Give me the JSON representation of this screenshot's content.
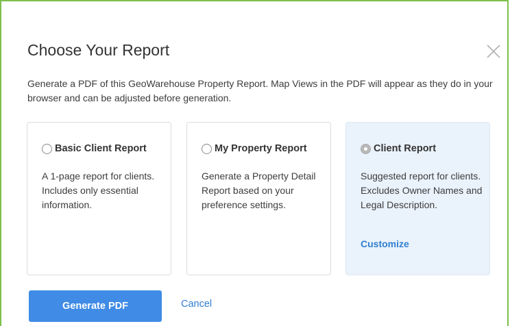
{
  "dialog": {
    "title": "Choose Your Report",
    "close_icon": "close-icon",
    "description": "Generate a PDF of this GeoWarehouse Property Report. Map Views in the PDF will appear as they do in your browser and can be adjusted before generation."
  },
  "options": [
    {
      "label": "Basic Client Report",
      "body": "A 1-page report for clients. Includes only essential information.",
      "selected": false
    },
    {
      "label": "My Property Report",
      "body": "Generate a Property Detail Report based on your preference settings.",
      "selected": false
    },
    {
      "label": "Client Report",
      "body": "Suggested report for clients. Excludes Owner Names and Legal Description.",
      "link": "Customize",
      "selected": true
    }
  ],
  "actions": {
    "generate_label": "Generate PDF",
    "cancel_label": "Cancel"
  },
  "colors": {
    "primary": "#3f8be6",
    "link": "#2f7fd1",
    "selected_card": "#eaf2fb",
    "frame": "#7cbf4a"
  }
}
